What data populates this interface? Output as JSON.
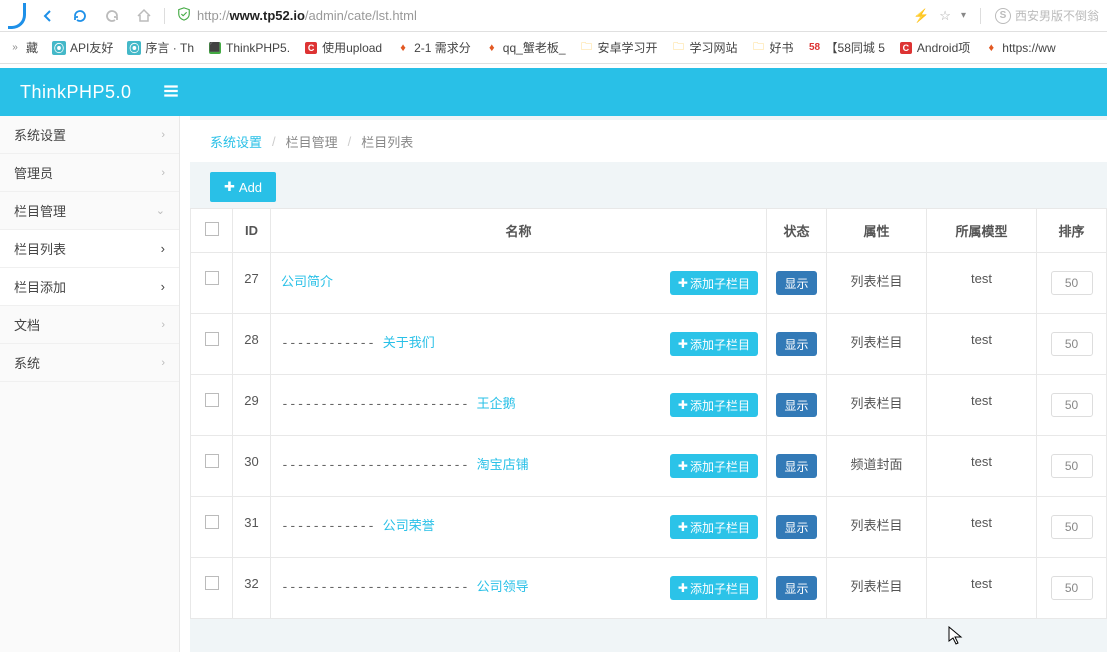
{
  "browser": {
    "url_prefix": "http://",
    "url_host": "www.tp52.io",
    "url_path": "/admin/cate/lst.html",
    "search_placeholder": "西安男版不倒翁"
  },
  "bookmarks": [
    {
      "label": "藏",
      "icon": "chev"
    },
    {
      "label": "API友好",
      "icon": "cyan-c"
    },
    {
      "label": "序言 · Th",
      "icon": "cyan-c"
    },
    {
      "label": "ThinkPHP5.",
      "icon": "green"
    },
    {
      "label": "使用upload",
      "icon": "red"
    },
    {
      "label": "2-1 需求分",
      "icon": "fire"
    },
    {
      "label": "qq_蟹老板_",
      "icon": "fire"
    },
    {
      "label": "安卓学习开",
      "icon": "folder"
    },
    {
      "label": "学习网站",
      "icon": "folder"
    },
    {
      "label": "好书",
      "icon": "folder"
    },
    {
      "label": "【58同城 5",
      "icon": "58"
    },
    {
      "label": "Android项",
      "icon": "red"
    },
    {
      "label": "https://ww",
      "icon": "fire"
    }
  ],
  "header": {
    "title": "ThinkPHP5.0"
  },
  "sidebar": [
    {
      "label": "系统设置",
      "expand": "right"
    },
    {
      "label": "管理员",
      "expand": "right"
    },
    {
      "label": "栏目管理",
      "expand": "down",
      "subs": [
        {
          "label": "栏目列表"
        },
        {
          "label": "栏目添加"
        }
      ]
    },
    {
      "label": "文档",
      "expand": "right"
    },
    {
      "label": "系统",
      "expand": "right"
    }
  ],
  "breadcrumb": {
    "root": "系统设置",
    "mid": "栏目管理",
    "leaf": "栏目列表"
  },
  "buttons": {
    "add": "Add",
    "sub": "添加子栏目",
    "show": "显示"
  },
  "table": {
    "headers": {
      "id": "ID",
      "name": "名称",
      "state": "状态",
      "attr": "属性",
      "model": "所属模型",
      "sort": "排序"
    },
    "rows": [
      {
        "id": "27",
        "indent": 0,
        "name": "公司简介",
        "attr": "列表栏目",
        "model": "test",
        "sort": "50"
      },
      {
        "id": "28",
        "indent": 1,
        "name": "关于我们",
        "attr": "列表栏目",
        "model": "test",
        "sort": "50"
      },
      {
        "id": "29",
        "indent": 2,
        "name": "王企鹅",
        "attr": "列表栏目",
        "model": "test",
        "sort": "50"
      },
      {
        "id": "30",
        "indent": 2,
        "name": "淘宝店铺",
        "attr": "频道封面",
        "model": "test",
        "sort": "50"
      },
      {
        "id": "31",
        "indent": 1,
        "name": "公司荣誉",
        "attr": "列表栏目",
        "model": "test",
        "sort": "50"
      },
      {
        "id": "32",
        "indent": 2,
        "name": "公司领导",
        "attr": "列表栏目",
        "model": "test",
        "sort": "50"
      }
    ]
  }
}
